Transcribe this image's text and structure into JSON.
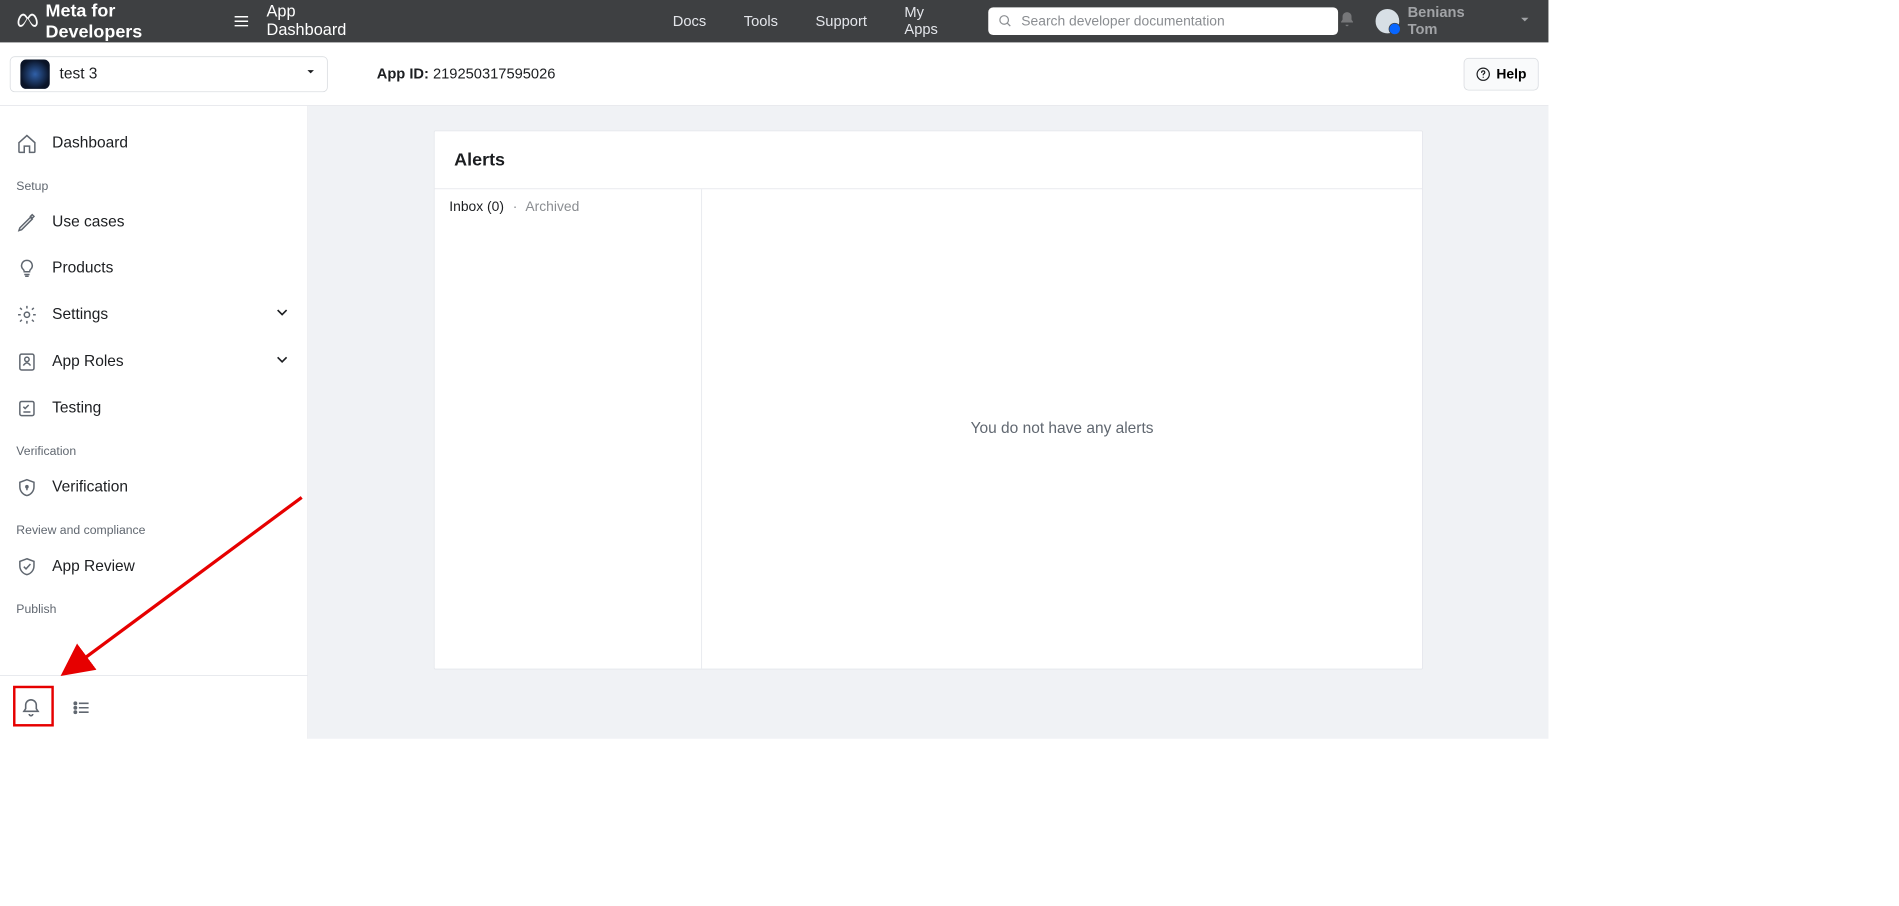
{
  "topbar": {
    "brand": "Meta for Developers",
    "title": "App Dashboard",
    "nav": [
      "Docs",
      "Tools",
      "Support",
      "My Apps"
    ],
    "search_placeholder": "Search developer documentation",
    "user_name": "Benians Tom"
  },
  "subbar": {
    "app_name": "test 3",
    "app_id_label": "App ID:",
    "app_id": "219250317595026",
    "help_label": "Help"
  },
  "sidebar": {
    "items": [
      {
        "label": "Dashboard"
      }
    ],
    "section_setup": "Setup",
    "setup_items": [
      {
        "label": "Use cases"
      },
      {
        "label": "Products"
      },
      {
        "label": "Settings"
      },
      {
        "label": "App Roles"
      },
      {
        "label": "Testing"
      }
    ],
    "section_verification": "Verification",
    "verification_items": [
      {
        "label": "Verification"
      }
    ],
    "section_review": "Review and compliance",
    "review_items": [
      {
        "label": "App Review"
      }
    ],
    "section_publish": "Publish"
  },
  "alerts": {
    "title": "Alerts",
    "inbox_label": "Inbox (0)",
    "archived_label": "Archived",
    "empty": "You do not have any alerts"
  }
}
